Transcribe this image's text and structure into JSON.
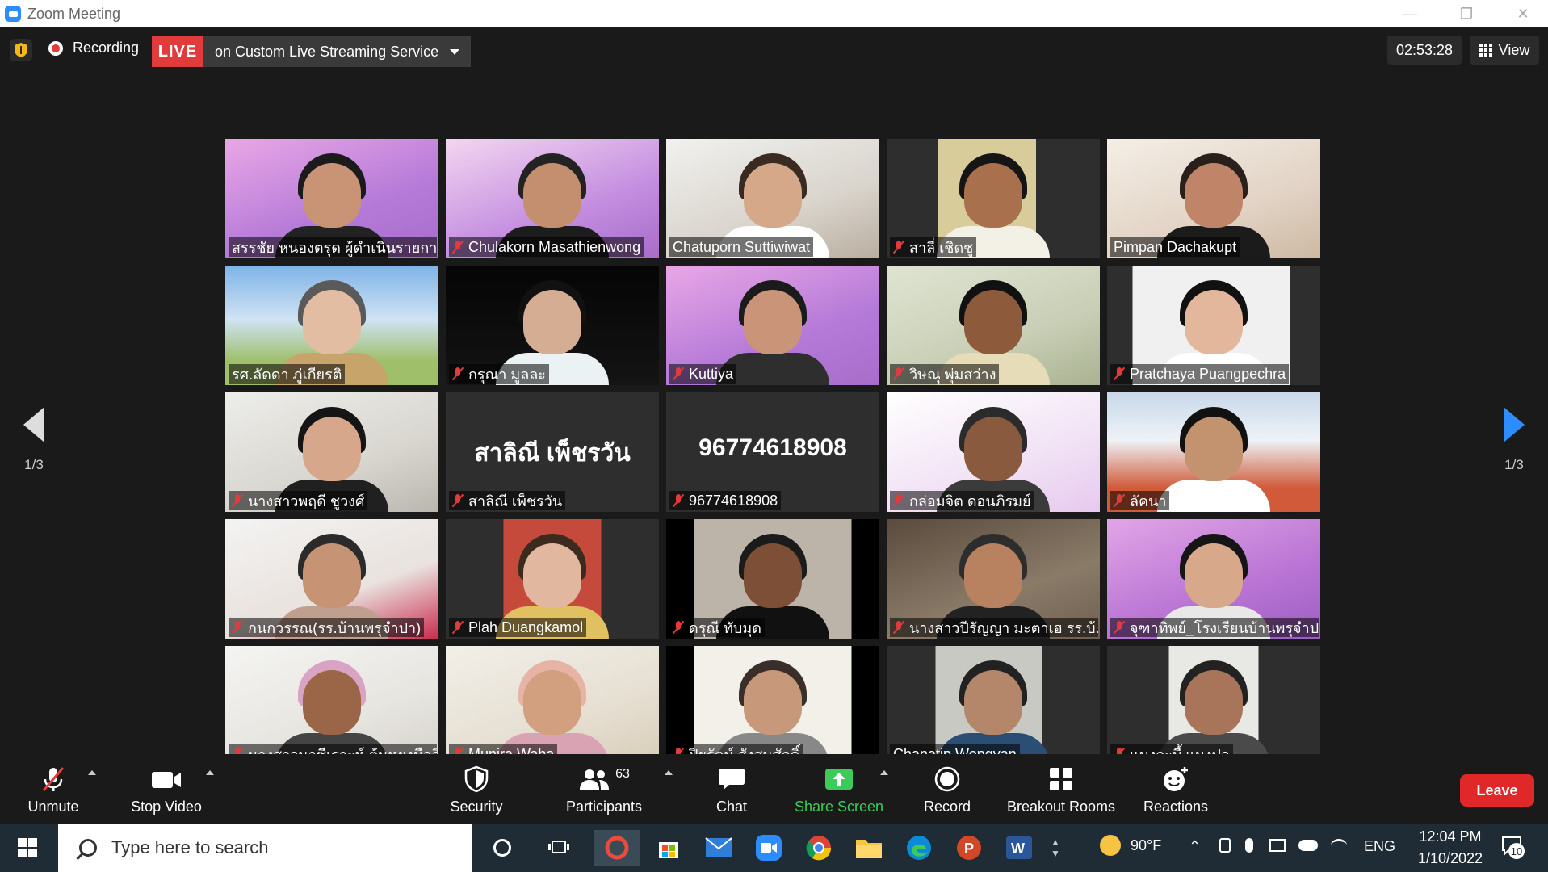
{
  "window": {
    "title": "Zoom Meeting"
  },
  "topbar": {
    "recording_label": "Recording",
    "live_label": "LIVE",
    "stream_label": "on Custom Live Streaming Service",
    "timer": "02:53:28",
    "view_label": "View"
  },
  "pager": {
    "left": "1/3",
    "right": "1/3"
  },
  "participants": [
    {
      "name": "สรรชัย หนองตรุด ผู้ดำเนินรายการ",
      "muted": false
    },
    {
      "name": "Chulakorn Masathienwong",
      "muted": true
    },
    {
      "name": "Chatuporn Suttiwiwat",
      "muted": false
    },
    {
      "name": "สาลี่ เชิดชู",
      "muted": true
    },
    {
      "name": "Pimpan Dachakupt",
      "muted": false
    },
    {
      "name": "รศ.ลัดดา ภู่เกียรติ",
      "muted": false
    },
    {
      "name": "กรุณา มูลละ",
      "muted": true
    },
    {
      "name": "Kuttiya",
      "muted": true
    },
    {
      "name": "วิษณุ พุ่มสว่าง",
      "muted": true
    },
    {
      "name": "Pratchaya Puangpechra",
      "muted": true
    },
    {
      "name": "นางสาวพฤดี ชูวงศ์",
      "muted": true
    },
    {
      "name": "สาลิณี เพ็ชรวัน",
      "muted": true,
      "display": "สาลิณี เพ็ชรวัน"
    },
    {
      "name": "96774618908",
      "muted": true,
      "display": "96774618908"
    },
    {
      "name": "กล่อมจิต ดอนภิรมย์",
      "muted": true
    },
    {
      "name": "ลัคนา",
      "muted": true
    },
    {
      "name": "กนกวรรณ(รร.บ้านพรุจำปา)",
      "muted": true
    },
    {
      "name": "Plah Duangkamol",
      "muted": true
    },
    {
      "name": "ดรุณี ทับมุด",
      "muted": true
    },
    {
      "name": "นางสาวปีรัญญา มะตาเฮ รร.บ้...",
      "muted": true
    },
    {
      "name": "จุฑาทิพย์_โรงเรียนบ้านพรุจำปา",
      "muted": true
    },
    {
      "name": "นางสาวนาซีเราะห์ ต้นหยงมือลี",
      "muted": true
    },
    {
      "name": "Munira Waha",
      "muted": true
    },
    {
      "name": "ปิยรัตน์ สังสมศักดิ์",
      "muted": true
    },
    {
      "name": "Chanatip Wongvan",
      "muted": false
    },
    {
      "name": "แมงกะบี้ แมงปอ",
      "muted": true
    }
  ],
  "toolbar": {
    "unmute": "Unmute",
    "stop_video": "Stop Video",
    "security": "Security",
    "participants": "Participants",
    "participants_count": "63",
    "chat": "Chat",
    "share_screen": "Share Screen",
    "record": "Record",
    "breakout_rooms": "Breakout Rooms",
    "reactions": "Reactions",
    "leave": "Leave"
  },
  "taskbar": {
    "search_placeholder": "Type here to search",
    "weather": "90°F",
    "language": "ENG",
    "time": "12:04 PM",
    "date": "1/10/2022",
    "notification_count": "10"
  },
  "colors": {
    "accent": "#2d8cff",
    "live": "#e23b3b",
    "leave": "#e02828",
    "share": "#3ccb5a"
  }
}
